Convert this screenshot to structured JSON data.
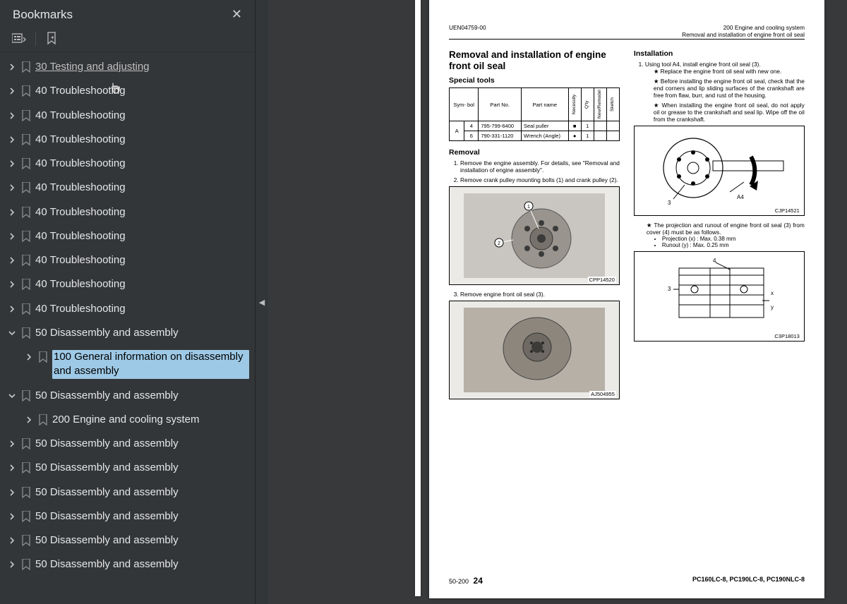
{
  "sidebar": {
    "title": "Bookmarks",
    "items": [
      {
        "label": "30 Testing and adjusting",
        "level": 0,
        "chevron": "right",
        "visited": true
      },
      {
        "label": "40 Troubleshooting",
        "level": 0,
        "chevron": "right"
      },
      {
        "label": "40 Troubleshooting",
        "level": 0,
        "chevron": "right"
      },
      {
        "label": "40 Troubleshooting",
        "level": 0,
        "chevron": "right"
      },
      {
        "label": "40 Troubleshooting",
        "level": 0,
        "chevron": "right"
      },
      {
        "label": "40 Troubleshooting",
        "level": 0,
        "chevron": "right"
      },
      {
        "label": "40 Troubleshooting",
        "level": 0,
        "chevron": "right"
      },
      {
        "label": "40 Troubleshooting",
        "level": 0,
        "chevron": "right"
      },
      {
        "label": "40 Troubleshooting",
        "level": 0,
        "chevron": "right"
      },
      {
        "label": "40 Troubleshooting",
        "level": 0,
        "chevron": "right"
      },
      {
        "label": "40 Troubleshooting",
        "level": 0,
        "chevron": "right"
      },
      {
        "label": "50 Disassembly and assembly",
        "level": 0,
        "chevron": "down"
      },
      {
        "label": "100 General information on disassembly and assembly",
        "level": 1,
        "chevron": "right",
        "selected": true
      },
      {
        "label": "50 Disassembly and assembly",
        "level": 0,
        "chevron": "down"
      },
      {
        "label": "200 Engine and cooling system",
        "level": 1,
        "chevron": "right"
      },
      {
        "label": "50 Disassembly and assembly",
        "level": 0,
        "chevron": "right"
      },
      {
        "label": "50 Disassembly and assembly",
        "level": 0,
        "chevron": "right"
      },
      {
        "label": "50 Disassembly and assembly",
        "level": 0,
        "chevron": "right"
      },
      {
        "label": "50 Disassembly and assembly",
        "level": 0,
        "chevron": "right"
      },
      {
        "label": "50 Disassembly and assembly",
        "level": 0,
        "chevron": "right"
      },
      {
        "label": "50 Disassembly and assembly",
        "level": 0,
        "chevron": "right"
      }
    ]
  },
  "page": {
    "doc_id": "UEN04759-00",
    "header_right_1": "200 Engine and cooling system",
    "header_right_2": "Removal and installation of engine front oil seal",
    "title": "Removal and installation of engine front oil seal",
    "special_tools_label": "Special tools",
    "tools_headers": {
      "symbol": "Sym-\nbol",
      "part_no": "Part No.",
      "part_name": "Part name",
      "necessity": "Necessity",
      "qty": "Q'ty",
      "new_remodel": "New/Remodel",
      "sketch": "Sketch"
    },
    "tools_rows": [
      {
        "sym": "A",
        "idx": "4",
        "part_no": "795-799-6400",
        "part_name": "Seal puller",
        "necessity": "■",
        "qty": "1",
        "new": "",
        "sketch": ""
      },
      {
        "sym": "",
        "idx": "6",
        "part_no": "790-331-1120",
        "part_name": "Wrench (Angle)",
        "necessity": "●",
        "qty": "1",
        "new": "",
        "sketch": ""
      }
    ],
    "removal_heading": "Removal",
    "removal_steps": [
      "Remove the engine assembly.  For details, see \"Removal and installation of engine assembly\".",
      "Remove crank pulley mounting bolts (1) and crank pulley (2).",
      "Remove engine front oil seal (3)."
    ],
    "fig_left_1": "CPP14520",
    "fig_left_2": "AJ504955",
    "installation_heading": "Installation",
    "install_step1": "Using tool A4, install engine front oil seal (3).",
    "install_bullets_1": [
      "Replace the engine front oil seal with new one.",
      "Before installing the engine front oil seal, check that the end corners and lip sliding surfaces of the crankshaft are free from flaw, burr, and rust of the housing.",
      "When installing the engine front oil seal, do not apply oil or grease to the crankshaft and seal lip.  Wipe off the oil from the crankshaft."
    ],
    "fig_right_1": "CJP14521",
    "install_bullets_2_intro": "The projection and runout of engine front oil seal (3) from cover (4) must be as follows.",
    "install_measures": [
      "Projection (x) : Max. 0.38 mm",
      "Runout (y)    : Max. 0.25 mm"
    ],
    "fig_right_2": "C3P18013",
    "footer_left": "50-200",
    "footer_page": "24",
    "footer_right": "PC160LC-8, PC190LC-8, PC190NLC-8"
  }
}
